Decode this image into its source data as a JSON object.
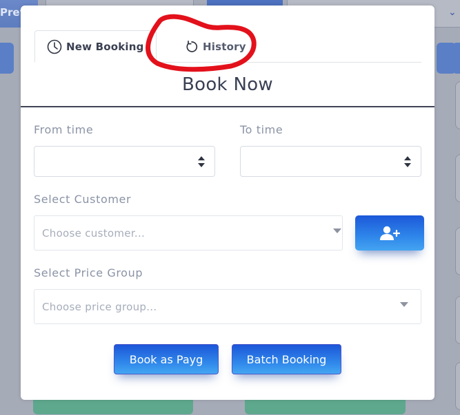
{
  "background": {
    "prev_label": "Prev"
  },
  "modal": {
    "tabs": [
      {
        "label": "New Booking",
        "icon": "clock-icon",
        "active": true
      },
      {
        "label": "History",
        "icon": "history-icon",
        "active": false
      }
    ],
    "title": "Book Now",
    "form": {
      "from_time": {
        "label": "From time",
        "value": ""
      },
      "to_time": {
        "label": "To time",
        "value": ""
      },
      "customer": {
        "label": "Select Customer",
        "placeholder": "Choose customer..."
      },
      "add_customer_icon": "user-plus-icon",
      "price_group": {
        "label": "Select Price Group",
        "placeholder": "Choose price group..."
      }
    },
    "actions": {
      "book_payg": "Book as Payg",
      "batch_booking": "Batch Booking"
    }
  },
  "colors": {
    "accent_gradient_top": "#1c56d8",
    "accent_gradient_bottom": "#43a6f2",
    "annotation_red": "#e3111b",
    "backdrop": "#a6abb8"
  }
}
